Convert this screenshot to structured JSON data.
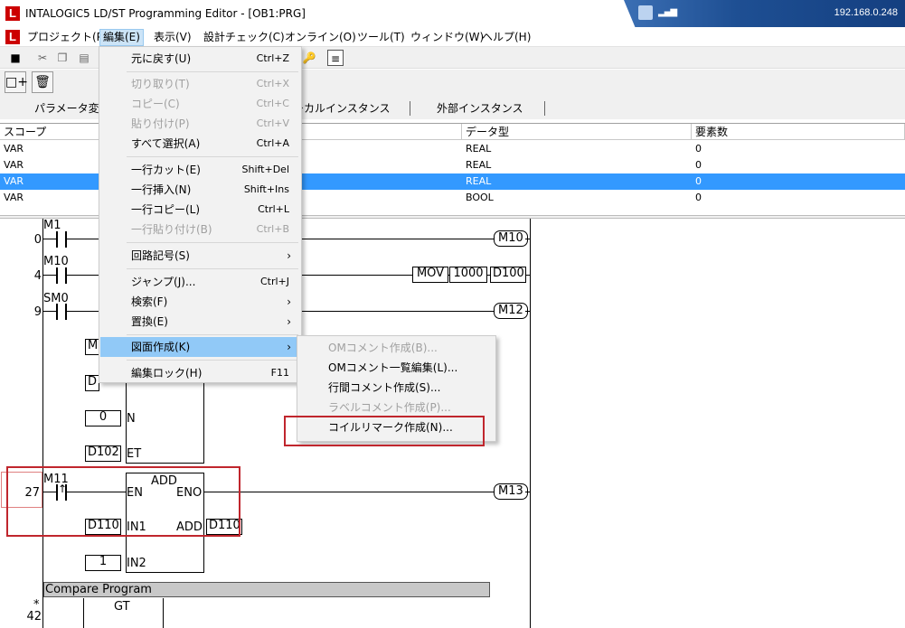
{
  "window": {
    "title": "INTALOGIC5 LD/ST Programming Editor - [OB1:PRG]",
    "app_icon": "L",
    "remote_ip": "192.168.0.248"
  },
  "menubar": {
    "items": [
      "プロジェクト(P)",
      "編集(E)",
      "表示(V)",
      "設計チェック(C)",
      "オンライン(O)",
      "ツール(T)",
      "ウィンドウ(W)",
      "ヘルプ(H)"
    ]
  },
  "tabs": [
    "パラメータ変数",
    "ローカルインスタンス",
    "外部インスタンス"
  ],
  "variable_table": {
    "columns": [
      "スコープ",
      "データ型",
      "要素数"
    ],
    "rows": [
      {
        "scope": "VAR",
        "type": "REAL",
        "count": "0"
      },
      {
        "scope": "VAR",
        "type": "REAL",
        "count": "0"
      },
      {
        "scope": "VAR",
        "type": "REAL",
        "count": "0"
      },
      {
        "scope": "VAR",
        "type": "BOOL",
        "count": "0"
      }
    ]
  },
  "edit_menu": {
    "items": [
      {
        "label": "元に戻す(U)",
        "shortcut": "Ctrl+Z",
        "disabled": false
      },
      {
        "label": "切り取り(T)",
        "shortcut": "Ctrl+X",
        "disabled": true
      },
      {
        "label": "コピー(C)",
        "shortcut": "Ctrl+C",
        "disabled": true
      },
      {
        "label": "貼り付け(P)",
        "shortcut": "Ctrl+V",
        "disabled": true
      },
      {
        "label": "すべて選択(A)",
        "shortcut": "Ctrl+A",
        "disabled": false
      },
      {
        "label": "一行カット(E)",
        "shortcut": "Shift+Del",
        "disabled": false
      },
      {
        "label": "一行挿入(N)",
        "shortcut": "Shift+Ins",
        "disabled": false
      },
      {
        "label": "一行コピー(L)",
        "shortcut": "Ctrl+L",
        "disabled": false
      },
      {
        "label": "一行貼り付け(B)",
        "shortcut": "Ctrl+B",
        "disabled": true
      },
      {
        "label": "回路記号(S)",
        "shortcut": "",
        "disabled": false
      },
      {
        "label": "ジャンプ(J)...",
        "shortcut": "Ctrl+J",
        "disabled": false
      },
      {
        "label": "検索(F)",
        "shortcut": "",
        "disabled": false
      },
      {
        "label": "置換(E)",
        "shortcut": "",
        "disabled": false
      },
      {
        "label": "図面作成(K)",
        "shortcut": "",
        "disabled": false
      },
      {
        "label": "編集ロック(H)",
        "shortcut": "F11",
        "disabled": false
      }
    ]
  },
  "submenu": {
    "items": [
      {
        "label": "OMコメント作成(B)...",
        "disabled": true
      },
      {
        "label": "OMコメント一覧編集(L)...",
        "disabled": false
      },
      {
        "label": "行間コメント作成(S)...",
        "disabled": false
      },
      {
        "label": "ラベルコメント作成(P)...",
        "disabled": true
      },
      {
        "label": "コイルリマーク作成(N)...",
        "disabled": false
      }
    ]
  },
  "ladder": {
    "rungs": [
      {
        "step": "0",
        "contact": "M1",
        "coil": "M10"
      },
      {
        "step": "4",
        "contact": "M10",
        "instruction": "MOV",
        "op1": "1000",
        "op2": "D100"
      },
      {
        "step": "9",
        "contact": "SM0",
        "coil": "M12"
      },
      {
        "step": "27",
        "contact": "M11",
        "coil": "M13"
      }
    ],
    "timer_block": {
      "in_partial": "M",
      "et_partial": "D",
      "n_value": "0",
      "n_label": "N",
      "et_value": "D102",
      "et_label": "ET"
    },
    "add_block": {
      "name": "ADD",
      "en": "EN",
      "eno": "ENO",
      "in1": "IN1",
      "in2": "IN2",
      "out_label": "ADD",
      "in1_value": "D110",
      "in2_value": "1",
      "out_value": "D110"
    },
    "compare": {
      "label": "Compare Program",
      "step": "42",
      "marker": "*",
      "gt": "GT"
    }
  }
}
